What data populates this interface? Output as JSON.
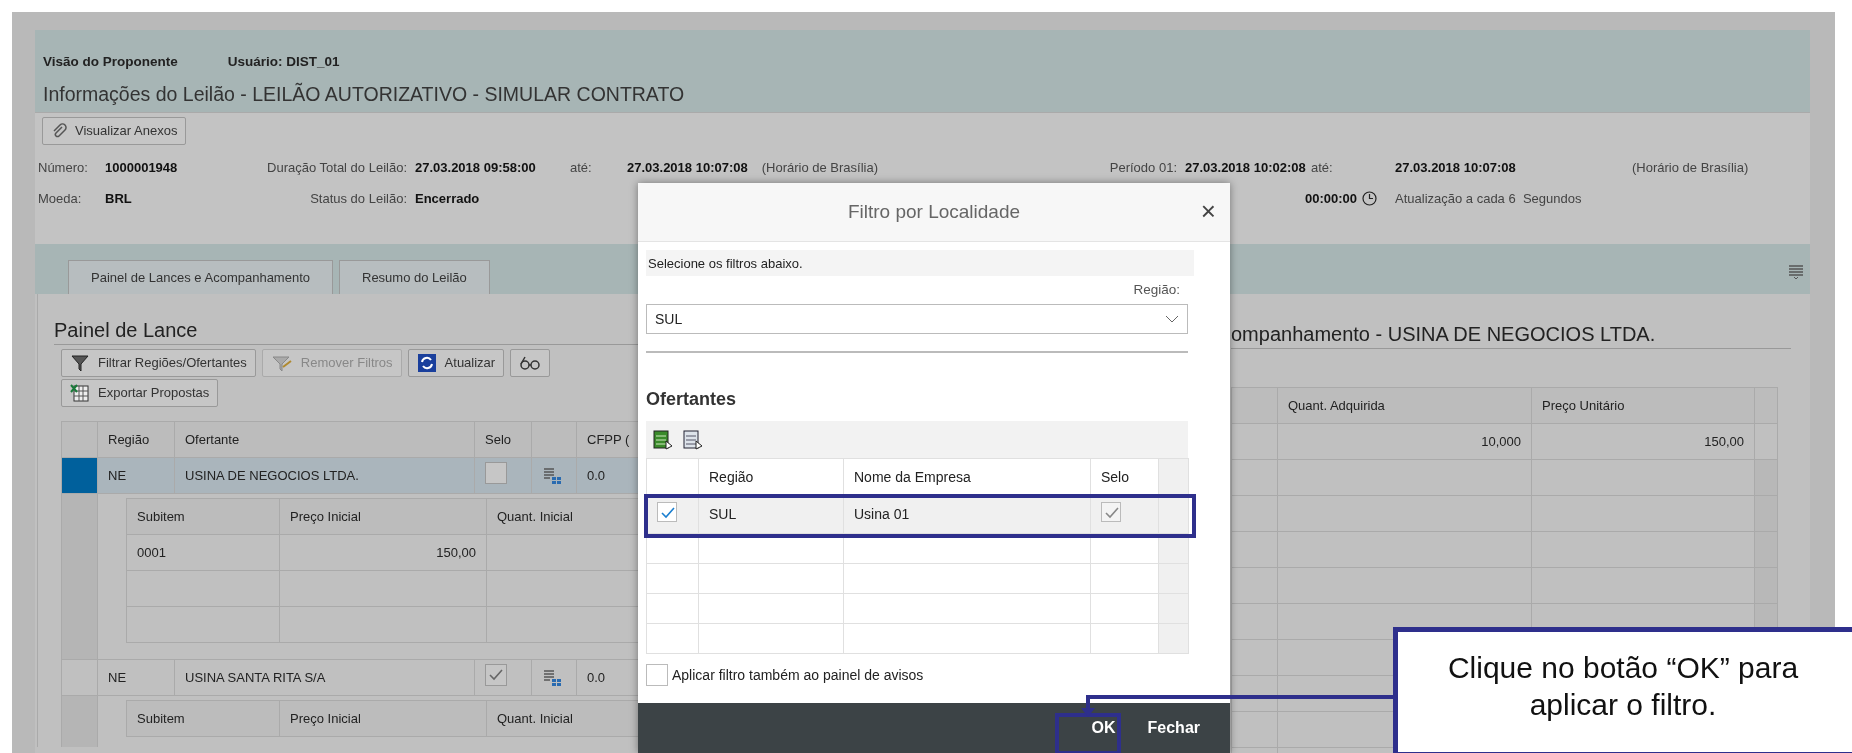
{
  "header": {
    "view_label": "Visão do Proponente",
    "user_label": "Usuário: DIST_01",
    "title": "Informações do Leilão - LEILÃO AUTORIZATIVO - SIMULAR CONTRATO"
  },
  "attachments_button": {
    "label": "Visualizar Anexos"
  },
  "info": {
    "numero": {
      "label": "Número:",
      "value": "1000001948"
    },
    "duracao": {
      "label": "Duração Total do Leilão:",
      "value": "27.03.2018 09:58:00"
    },
    "duracao_ate": {
      "label": "até:",
      "value": "27.03.2018 10:07:08"
    },
    "duracao_fuso": "(Horário de Brasília)",
    "periodo": {
      "label": "Período 01:",
      "value": "27.03.2018 10:02:08"
    },
    "periodo_ate": {
      "label": "até:",
      "value": "27.03.2018 10:07:08"
    },
    "periodo_fuso": "(Horário de Brasília)",
    "moeda": {
      "label": "Moeda:",
      "value": "BRL"
    },
    "status": {
      "label": "Status do Leilão:",
      "value": "Encerrado"
    },
    "timer": "00:00:00",
    "refresh": "Atualização a cada 6  Segundos"
  },
  "tabs": [
    "Painel de Lances e Acompanhamento",
    "Resumo do Leilão"
  ],
  "bid_panel": {
    "title": "Painel de Lance",
    "toolbar": [
      {
        "kind": "filter",
        "label": "Filtrar Regiões/Ofertantes",
        "disabled": false
      },
      {
        "kind": "filter-remove",
        "label": "Remover Filtros",
        "disabled": true
      },
      {
        "kind": "refresh",
        "label": "Atualizar",
        "disabled": false
      },
      {
        "kind": "glasses",
        "disabled": false
      },
      {
        "kind": "export",
        "label": "Exportar Propostas",
        "disabled": false
      }
    ],
    "columns": [
      "Região",
      "Ofertante",
      "Selo",
      "CFPP ("
    ],
    "rows": [
      {
        "selected": true,
        "regiao": "NE",
        "ofertante": "USINA DE NEGOCIOS LTDA.",
        "selo": false,
        "cfpp": "0.0",
        "subitems": {
          "columns": [
            "Subitem",
            "Preço Inicial",
            "Quant. Inicial"
          ],
          "rows": [
            {
              "subitem": "0001",
              "preco": "150,00"
            }
          ]
        }
      },
      {
        "selected": false,
        "regiao": "NE",
        "ofertante": "USINA SANTA RITA S/A",
        "selo": true,
        "cfpp": "0.0",
        "subitems": {
          "columns": [
            "Subitem",
            "Preço Inicial",
            "Quant. Inicial"
          ]
        }
      }
    ]
  },
  "tracking_panel": {
    "title": "ompanhamento - USINA DE NEGOCIOS LTDA.",
    "columns": [
      "Quant. Adquirida",
      "Preço Unitário"
    ],
    "rows": [
      {
        "quant": "10,000",
        "preco": "150,00"
      }
    ]
  },
  "dialog": {
    "title": "Filtro por Localidade",
    "close": "×",
    "instruction": "Selecione os filtros abaixo.",
    "region_label": "Região:",
    "region_value": "SUL",
    "section_title": "Ofertantes",
    "columns": [
      "Região",
      "Nome da Empresa",
      "Selo"
    ],
    "rows": [
      {
        "checked": true,
        "regiao": "SUL",
        "empresa": "Usina 01",
        "selo": true
      }
    ],
    "apply_also": {
      "label": "Aplicar filtro também ao painel de avisos",
      "checked": false
    },
    "buttons": [
      {
        "label": "OK"
      },
      {
        "label": "Fechar"
      }
    ]
  },
  "callout": {
    "text": "Clique no botão “OK” para aplicar o filtro."
  }
}
